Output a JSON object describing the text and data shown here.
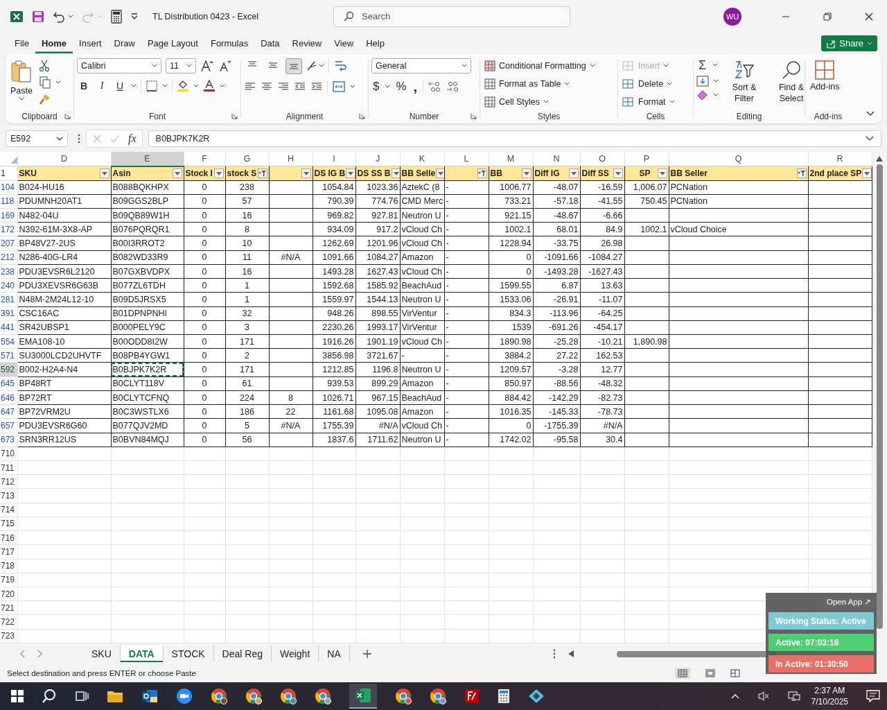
{
  "title_bar": {
    "title": "TL Distribution 0423  -  Excel",
    "search_placeholder": "Search",
    "avatar": "WU",
    "redo_disabled": true
  },
  "menu_tabs": [
    {
      "label": "File",
      "selected": false
    },
    {
      "label": "Home",
      "selected": true
    },
    {
      "label": "Insert",
      "selected": false
    },
    {
      "label": "Draw",
      "selected": false
    },
    {
      "label": "Page Layout",
      "selected": false
    },
    {
      "label": "Formulas",
      "selected": false
    },
    {
      "label": "Data",
      "selected": false
    },
    {
      "label": "Review",
      "selected": false
    },
    {
      "label": "View",
      "selected": false
    },
    {
      "label": "Help",
      "selected": false
    }
  ],
  "share_button": "Share",
  "ribbon": {
    "clipboard": {
      "paste": "Paste",
      "group": "Clipboard"
    },
    "font": {
      "family": "Calibri",
      "size": "11",
      "bold": "B",
      "italic": "I",
      "underline": "U",
      "group": "Font"
    },
    "alignment": {
      "group": "Alignment",
      "vertical": [
        {
          "selected": false
        },
        {
          "selected": false
        },
        {
          "selected": true
        }
      ]
    },
    "number": {
      "format": "General",
      "currency": "$",
      "percent": "%",
      "comma": ",",
      "group": "Number"
    },
    "styles": {
      "items": [
        "Conditional Formatting",
        "Format as Table",
        "Cell Styles"
      ],
      "group": "Styles"
    },
    "cells": {
      "items": [
        {
          "label": "Insert",
          "disabled": true
        },
        {
          "label": "Delete",
          "disabled": false
        },
        {
          "label": "Format",
          "disabled": false
        }
      ],
      "group": "Cells"
    },
    "editing": {
      "autosum": "Σ",
      "sort": "Sort & Filter",
      "find": "Find & Select",
      "group": "Editing"
    },
    "addins": {
      "label": "Add-ins",
      "group": "Add-ins"
    }
  },
  "formula_bar": {
    "name_box": "E592",
    "fx": "fx",
    "value": "B0BJPK7K2R"
  },
  "sheet": {
    "header_row": "1",
    "columns": [
      {
        "letter": "D",
        "header": "SKU",
        "filtered": false,
        "selected": false
      },
      {
        "letter": "E",
        "header": "Asin",
        "filtered": false,
        "selected": true
      },
      {
        "letter": "F",
        "header": "Stock I",
        "filtered": false,
        "selected": false
      },
      {
        "letter": "G",
        "header": "stock S",
        "filtered": true,
        "selected": false
      },
      {
        "letter": "H",
        "filtered": false,
        "selected": false
      },
      {
        "letter": "I",
        "header": "DS IG B",
        "filtered": false,
        "selected": false
      },
      {
        "letter": "J",
        "header": "DS SS B",
        "filtered": false,
        "selected": false
      },
      {
        "letter": "K",
        "header": "BB Selle",
        "filtered": false,
        "selected": false
      },
      {
        "letter": "L",
        "filtered": true,
        "selected": false
      },
      {
        "letter": "M",
        "header": "BB",
        "filtered": false,
        "selected": false
      },
      {
        "letter": "N",
        "header": "Diff IG",
        "filtered": false,
        "selected": false
      },
      {
        "letter": "O",
        "header": "Diff SS",
        "filtered": false,
        "selected": false
      },
      {
        "letter": "P",
        "header": "SP",
        "filtered": false,
        "selected": false
      },
      {
        "letter": "Q",
        "header": "BB Seller",
        "filtered": true,
        "selected": false
      },
      {
        "letter": "R",
        "header": "2nd place SP",
        "filtered": false,
        "selected": false
      }
    ],
    "rows": [
      {
        "row": "104",
        "filtered": true,
        "selected": false,
        "cells": {
          "D": "B024-HU16",
          "E": "B088BQKHPX",
          "F": "0",
          "G": "238",
          "I": "1054.84",
          "J": "1023.36",
          "K": "AztekC (8",
          "L": "-",
          "M": "1006.77",
          "N": "-48.07",
          "O": "-16.59",
          "P": "1,006.07",
          "Q": "PCNation"
        }
      },
      {
        "row": "118",
        "filtered": true,
        "selected": false,
        "cells": {
          "D": "PDUMNH20AT1",
          "E": "B09GGS2BLP",
          "F": "0",
          "G": "57",
          "I": "790.39",
          "J": "774.76",
          "K": "CMD Merc",
          "L": "-",
          "M": "733.21",
          "N": "-57.18",
          "O": "-41.55",
          "P": "750.45",
          "Q": "PCNation"
        }
      },
      {
        "row": "169",
        "filtered": true,
        "selected": false,
        "cells": {
          "D": "N482-04U",
          "E": "B09QB89W1H",
          "F": "0",
          "G": "16",
          "I": "969.82",
          "J": "927.81",
          "K": "Neutron U",
          "L": "-",
          "M": "921.15",
          "N": "-48.67",
          "O": "-6.66"
        }
      },
      {
        "row": "172",
        "filtered": true,
        "selected": false,
        "cells": {
          "D": "N392-61M-3X8-AP",
          "E": "B076PQRQR1",
          "F": "0",
          "G": "8",
          "I": "934.09",
          "J": "917.2",
          "K": "vCloud Ch",
          "L": "-",
          "M": "1002.1",
          "N": "68.01",
          "O": "84.9",
          "P": "1002.1",
          "Q": "vCloud Choice"
        }
      },
      {
        "row": "207",
        "filtered": true,
        "selected": false,
        "cells": {
          "D": "BP48V27-2US",
          "E": "B00I3RROT2",
          "F": "0",
          "G": "10",
          "I": "1262.69",
          "J": "1201.96",
          "K": "vCloud Ch",
          "L": "-",
          "M": "1228.94",
          "N": "-33.75",
          "O": "26.98"
        }
      },
      {
        "row": "212",
        "filtered": true,
        "selected": false,
        "cells": {
          "D": "N286-40G-LR4",
          "E": "B082WD33R9",
          "F": "0",
          "G": "11",
          "H": "#N/A",
          "I": "1091.66",
          "J": "1084.27",
          "K": "Amazon",
          "L": "-",
          "M": "0",
          "N": "-1091.66",
          "O": "-1084.27"
        }
      },
      {
        "row": "238",
        "filtered": true,
        "selected": false,
        "cells": {
          "D": "PDU3EVSR6L2120",
          "E": "B07GXBVDPX",
          "F": "0",
          "G": "16",
          "I": "1493.28",
          "J": "1627.43",
          "K": "vCloud Ch",
          "L": "-",
          "M": "0",
          "N": "-1493.28",
          "O": "-1627.43"
        }
      },
      {
        "row": "240",
        "filtered": true,
        "selected": false,
        "cells": {
          "D": "PDU3XEVSR6G63B",
          "E": "B077ZL6TDH",
          "F": "0",
          "G": "1",
          "I": "1592.68",
          "J": "1585.92",
          "K": "BeachAud",
          "L": "-",
          "M": "1599.55",
          "N": "6.87",
          "O": "13.63"
        }
      },
      {
        "row": "281",
        "filtered": true,
        "selected": false,
        "cells": {
          "D": "N48M-2M24L12-10",
          "E": "B09D5JRSX5",
          "F": "0",
          "G": "1",
          "I": "1559.97",
          "J": "1544.13",
          "K": "Neutron U",
          "L": "-",
          "M": "1533.06",
          "N": "-26.91",
          "O": "-11.07"
        }
      },
      {
        "row": "391",
        "filtered": true,
        "selected": false,
        "cells": {
          "D": "CSC16AC",
          "E": "B01DPNPNHI",
          "F": "0",
          "G": "32",
          "I": "948.26",
          "J": "898.55",
          "K": "VirVentur",
          "L": "-",
          "M": "834.3",
          "N": "-113.96",
          "O": "-64.25"
        }
      },
      {
        "row": "441",
        "filtered": true,
        "selected": false,
        "cells": {
          "D": "SR42UBSP1",
          "E": "B000PELY9C",
          "F": "0",
          "G": "3",
          "I": "2230.26",
          "J": "1993.17",
          "K": "VirVentur",
          "L": "-",
          "M": "1539",
          "N": "-691.26",
          "O": "-454.17"
        }
      },
      {
        "row": "554",
        "filtered": true,
        "selected": false,
        "cells": {
          "D": "EMA108-10",
          "E": "B00ODD8I2W",
          "F": "0",
          "G": "171",
          "I": "1916.26",
          "J": "1901.19",
          "K": "vCloud Ch",
          "L": "-",
          "M": "1890.98",
          "N": "-25.28",
          "O": "-10.21",
          "P": "1,890.98"
        }
      },
      {
        "row": "571",
        "filtered": true,
        "selected": false,
        "cells": {
          "D": "SU3000LCD2UHVTF",
          "E": "B08PB4YGW1",
          "F": "0",
          "G": "2",
          "I": "3856.98",
          "J": "3721.67",
          "K": "-",
          "L": "-",
          "M": "3884.2",
          "N": "27.22",
          "O": "162.53"
        }
      },
      {
        "row": "592",
        "filtered": true,
        "selected": true,
        "cells": {
          "D": "B002-H2A4-N4",
          "E": "B0BJPK7K2R",
          "F": "0",
          "G": "171",
          "I": "1212.85",
          "J": "1196.8",
          "K": "Neutron U",
          "L": "-",
          "M": "1209.57",
          "N": "-3.28",
          "O": "12.77"
        }
      },
      {
        "row": "645",
        "filtered": true,
        "selected": false,
        "cells": {
          "D": "BP48RT",
          "E": "B0CLYT118V",
          "F": "0",
          "G": "61",
          "I": "939.53",
          "J": "899.29",
          "K": "Amazon",
          "L": "-",
          "M": "850.97",
          "N": "-88.56",
          "O": "-48.32"
        }
      },
      {
        "row": "646",
        "filtered": true,
        "selected": false,
        "cells": {
          "D": "BP72RT",
          "E": "B0CLYTCFNQ",
          "F": "0",
          "G": "224",
          "H": "8",
          "I": "1026.71",
          "J": "967.15",
          "K": "BeachAud",
          "L": "-",
          "M": "884.42",
          "N": "-142.29",
          "O": "-82.73"
        }
      },
      {
        "row": "647",
        "filtered": true,
        "selected": false,
        "cells": {
          "D": "BP72VRM2U",
          "E": "B0C3WSTLX6",
          "F": "0",
          "G": "186",
          "H": "22",
          "I": "1161.68",
          "J": "1095.08",
          "K": "Amazon",
          "L": "-",
          "M": "1016.35",
          "N": "-145.33",
          "O": "-78.73"
        }
      },
      {
        "row": "657",
        "filtered": true,
        "selected": false,
        "cells": {
          "D": "PDU3EVSR6G60",
          "E": "B077QJV2MD",
          "F": "0",
          "G": "5",
          "H": "#N/A",
          "I": "1755.39",
          "J": "#N/A",
          "K": "vCloud Ch",
          "L": "-",
          "M": "0",
          "N": "-1755.39",
          "O": "#N/A"
        }
      },
      {
        "row": "673",
        "filtered": true,
        "selected": false,
        "cells": {
          "D": "SRN3RR12US",
          "E": "B0BVN84MQJ",
          "F": "0",
          "G": "56",
          "I": "1837.6",
          "J": "1711.62",
          "K": "Neutron U",
          "L": "-",
          "M": "1742.02",
          "N": "-95.58",
          "O": "30.4"
        }
      },
      {
        "row": "710",
        "filtered": false,
        "selected": false
      },
      {
        "row": "711",
        "filtered": false,
        "selected": false
      },
      {
        "row": "712",
        "filtered": false,
        "selected": false
      },
      {
        "row": "713",
        "filtered": false,
        "selected": false
      },
      {
        "row": "714",
        "filtered": false,
        "selected": false
      },
      {
        "row": "715",
        "filtered": false,
        "selected": false
      },
      {
        "row": "716",
        "filtered": false,
        "selected": false
      },
      {
        "row": "717",
        "filtered": false,
        "selected": false
      },
      {
        "row": "718",
        "filtered": false,
        "selected": false
      },
      {
        "row": "719",
        "filtered": false,
        "selected": false
      },
      {
        "row": "720",
        "filtered": false,
        "selected": false
      },
      {
        "row": "721",
        "filtered": false,
        "selected": false
      },
      {
        "row": "722",
        "filtered": false,
        "selected": false
      },
      {
        "row": "723",
        "filtered": false,
        "selected": false
      }
    ]
  },
  "sheet_tabs": [
    {
      "label": "SKU",
      "selected": false
    },
    {
      "label": "DATA",
      "selected": true
    },
    {
      "label": "STOCK",
      "selected": false
    },
    {
      "label": "Deal Reg",
      "selected": false
    },
    {
      "label": "Weight",
      "selected": false
    },
    {
      "label": "NA",
      "selected": false
    }
  ],
  "status_bar": {
    "message": "Select destination and press ENTER or choose Paste"
  },
  "tracker": {
    "open_app": "Open App ↗",
    "items": [
      {
        "label": "Working Status: Active",
        "color": "#7ecad3"
      },
      {
        "label": "Active: 07:03:18",
        "color": "#4ccf72"
      },
      {
        "label": "In Active: 01:30:50",
        "color": "#e96e66"
      }
    ]
  },
  "taskbar": {
    "time": "2:37 AM",
    "date": "7/10/2025"
  }
}
